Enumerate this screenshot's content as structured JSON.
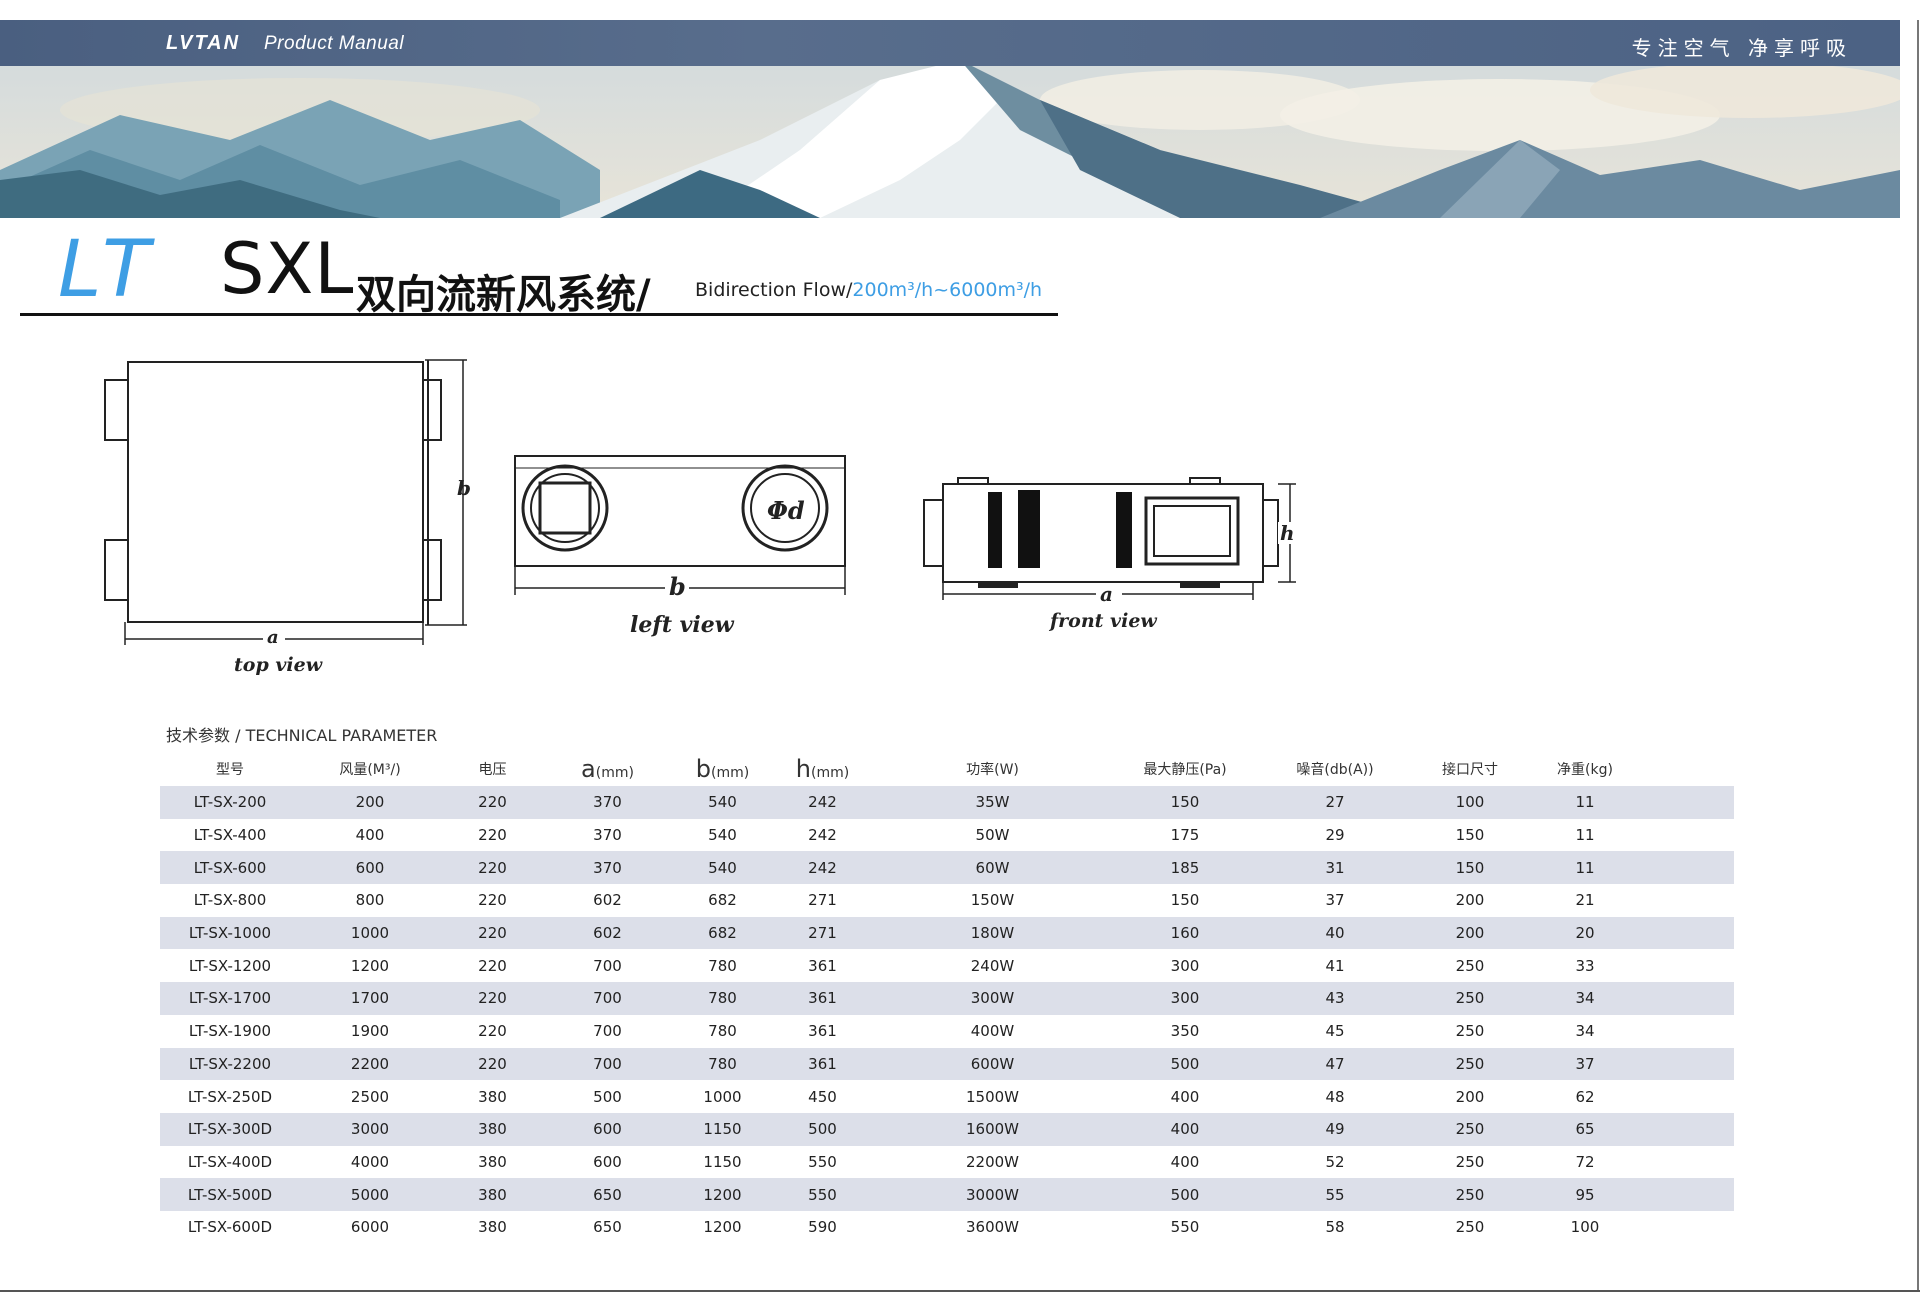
{
  "header": {
    "brand": "LVTAN",
    "subtitle": "Product Manual",
    "slogan": "专注空气 净享呼吸"
  },
  "title": {
    "series": "LT",
    "model": "SXL",
    "name_cn": "双向流新风系统/",
    "name_en": "Bidirection Flow/",
    "flow_range": "200m³/h~6000m³/h"
  },
  "drawings": {
    "top_view": {
      "label": "top view",
      "dim_a": "a",
      "dim_b": "b"
    },
    "left_view": {
      "label": "left view",
      "dim_b": "b",
      "duct": "Φd"
    },
    "front_view": {
      "label": "front view",
      "dim_a": "a",
      "dim_h": "h"
    }
  },
  "table": {
    "caption": "技术参数 / TECHNICAL PARAMETER",
    "headers": [
      {
        "main": "型号",
        "unit": ""
      },
      {
        "main": "风量(M³/)",
        "unit": ""
      },
      {
        "main": "电压",
        "unit": ""
      },
      {
        "main": "a",
        "unit": "(mm)"
      },
      {
        "main": "b",
        "unit": "(mm)"
      },
      {
        "main": "h",
        "unit": "(mm)"
      },
      {
        "main": "功率(W)",
        "unit": ""
      },
      {
        "main": "最大静压(Pa)",
        "unit": ""
      },
      {
        "main": "噪音(db(A))",
        "unit": ""
      },
      {
        "main": "接口尺寸",
        "unit": ""
      },
      {
        "main": "净重(kg)",
        "unit": ""
      }
    ],
    "rows": [
      [
        "LT-SX-200",
        "200",
        "220",
        "370",
        "540",
        "242",
        "35W",
        "150",
        "27",
        "100",
        "11"
      ],
      [
        "LT-SX-400",
        "400",
        "220",
        "370",
        "540",
        "242",
        "50W",
        "175",
        "29",
        "150",
        "11"
      ],
      [
        "LT-SX-600",
        "600",
        "220",
        "370",
        "540",
        "242",
        "60W",
        "185",
        "31",
        "150",
        "11"
      ],
      [
        "LT-SX-800",
        "800",
        "220",
        "602",
        "682",
        "271",
        "150W",
        "150",
        "37",
        "200",
        "21"
      ],
      [
        "LT-SX-1000",
        "1000",
        "220",
        "602",
        "682",
        "271",
        "180W",
        "160",
        "40",
        "200",
        "20"
      ],
      [
        "LT-SX-1200",
        "1200",
        "220",
        "700",
        "780",
        "361",
        "240W",
        "300",
        "41",
        "250",
        "33"
      ],
      [
        "LT-SX-1700",
        "1700",
        "220",
        "700",
        "780",
        "361",
        "300W",
        "300",
        "43",
        "250",
        "34"
      ],
      [
        "LT-SX-1900",
        "1900",
        "220",
        "700",
        "780",
        "361",
        "400W",
        "350",
        "45",
        "250",
        "34"
      ],
      [
        "LT-SX-2200",
        "2200",
        "220",
        "700",
        "780",
        "361",
        "600W",
        "500",
        "47",
        "250",
        "37"
      ],
      [
        "LT-SX-250D",
        "2500",
        "380",
        "500",
        "1000",
        "450",
        "1500W",
        "400",
        "48",
        "200",
        "62"
      ],
      [
        "LT-SX-300D",
        "3000",
        "380",
        "600",
        "1150",
        "500",
        "1600W",
        "400",
        "49",
        "250",
        "65"
      ],
      [
        "LT-SX-400D",
        "4000",
        "380",
        "600",
        "1150",
        "550",
        "2200W",
        "400",
        "52",
        "250",
        "72"
      ],
      [
        "LT-SX-500D",
        "5000",
        "380",
        "650",
        "1200",
        "550",
        "3000W",
        "500",
        "55",
        "250",
        "95"
      ],
      [
        "LT-SX-600D",
        "6000",
        "380",
        "650",
        "1200",
        "590",
        "3600W",
        "550",
        "58",
        "250",
        "100"
      ]
    ]
  }
}
